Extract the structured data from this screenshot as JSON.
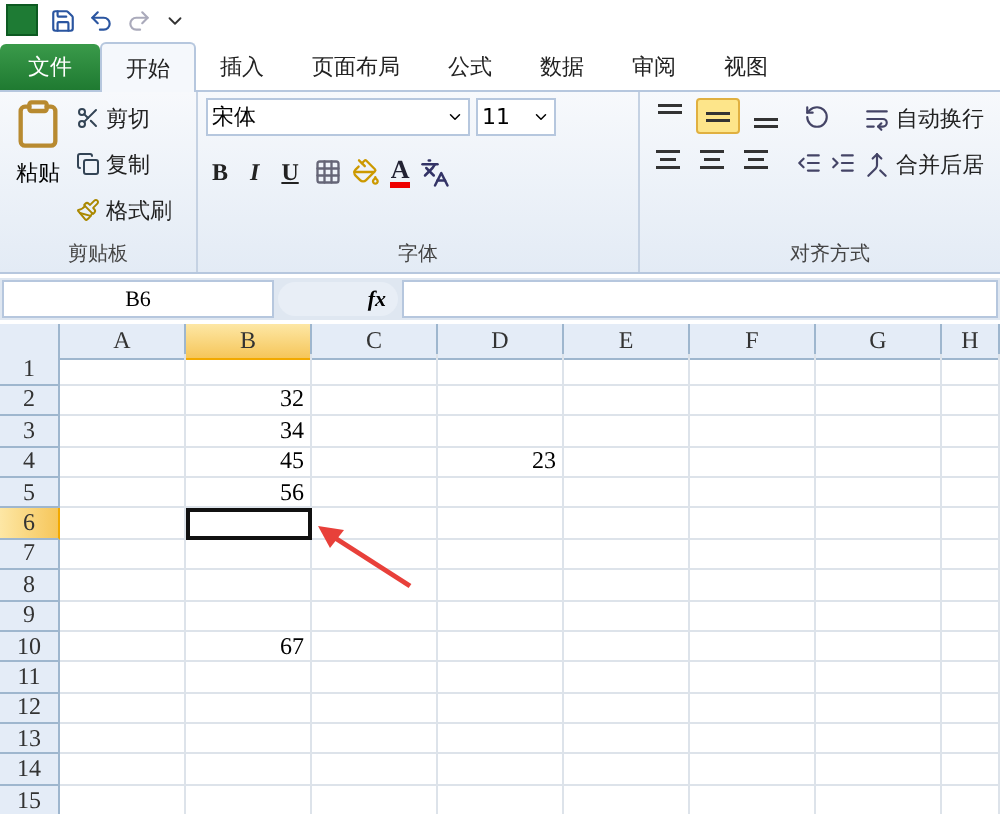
{
  "tabs": [
    {
      "label": "文件",
      "kind": "file",
      "selected": false
    },
    {
      "label": "开始",
      "kind": "tab",
      "selected": true
    },
    {
      "label": "插入",
      "kind": "tab",
      "selected": false
    },
    {
      "label": "页面布局",
      "kind": "tab",
      "selected": false
    },
    {
      "label": "公式",
      "kind": "tab",
      "selected": false
    },
    {
      "label": "数据",
      "kind": "tab",
      "selected": false
    },
    {
      "label": "审阅",
      "kind": "tab",
      "selected": false
    },
    {
      "label": "视图",
      "kind": "tab",
      "selected": false
    }
  ],
  "clipboard": {
    "paste": "粘贴",
    "cut": "剪切",
    "copy": "复制",
    "format_painter": "格式刷",
    "label": "剪贴板"
  },
  "font": {
    "name": "宋体",
    "size": "11",
    "bold": "B",
    "italic": "I",
    "underline": "U",
    "font_color": "A",
    "label": "字体"
  },
  "alignment": {
    "vertical": [
      {
        "kind": "top",
        "selected": false
      },
      {
        "kind": "middle",
        "selected": true
      },
      {
        "kind": "bottom",
        "selected": false
      }
    ],
    "wrap": "自动换行",
    "merge": "合并后居",
    "label": "对齐方式"
  },
  "formula_bar": {
    "name_box": "B6",
    "fx": "fx"
  },
  "columns": [
    {
      "label": "A",
      "selected": false
    },
    {
      "label": "B",
      "selected": true
    },
    {
      "label": "C",
      "selected": false
    },
    {
      "label": "D",
      "selected": false
    },
    {
      "label": "E",
      "selected": false
    },
    {
      "label": "F",
      "selected": false
    },
    {
      "label": "G",
      "selected": false
    },
    {
      "label": "H",
      "selected": false
    }
  ],
  "rows": [
    {
      "label": "1",
      "selected": false,
      "cells": {}
    },
    {
      "label": "2",
      "selected": false,
      "cells": {
        "B": {
          "value": "32",
          "selected": false
        }
      }
    },
    {
      "label": "3",
      "selected": false,
      "cells": {
        "B": {
          "value": "34",
          "selected": false
        }
      }
    },
    {
      "label": "4",
      "selected": false,
      "cells": {
        "B": {
          "value": "45",
          "selected": false
        },
        "D": {
          "value": "23",
          "selected": false
        }
      }
    },
    {
      "label": "5",
      "selected": false,
      "cells": {
        "B": {
          "value": "56",
          "selected": false
        }
      }
    },
    {
      "label": "6",
      "selected": true,
      "cells": {
        "B": {
          "selected": true
        }
      }
    },
    {
      "label": "7",
      "selected": false,
      "cells": {}
    },
    {
      "label": "8",
      "selected": false,
      "cells": {}
    },
    {
      "label": "9",
      "selected": false,
      "cells": {}
    },
    {
      "label": "10",
      "selected": false,
      "cells": {
        "B": {
          "value": "67",
          "selected": false
        }
      }
    },
    {
      "label": "11",
      "selected": false,
      "cells": {}
    },
    {
      "label": "12",
      "selected": false,
      "cells": {}
    },
    {
      "label": "13",
      "selected": false,
      "cells": {}
    },
    {
      "label": "14",
      "selected": false,
      "cells": {}
    },
    {
      "label": "15",
      "selected": false,
      "cells": {}
    }
  ]
}
